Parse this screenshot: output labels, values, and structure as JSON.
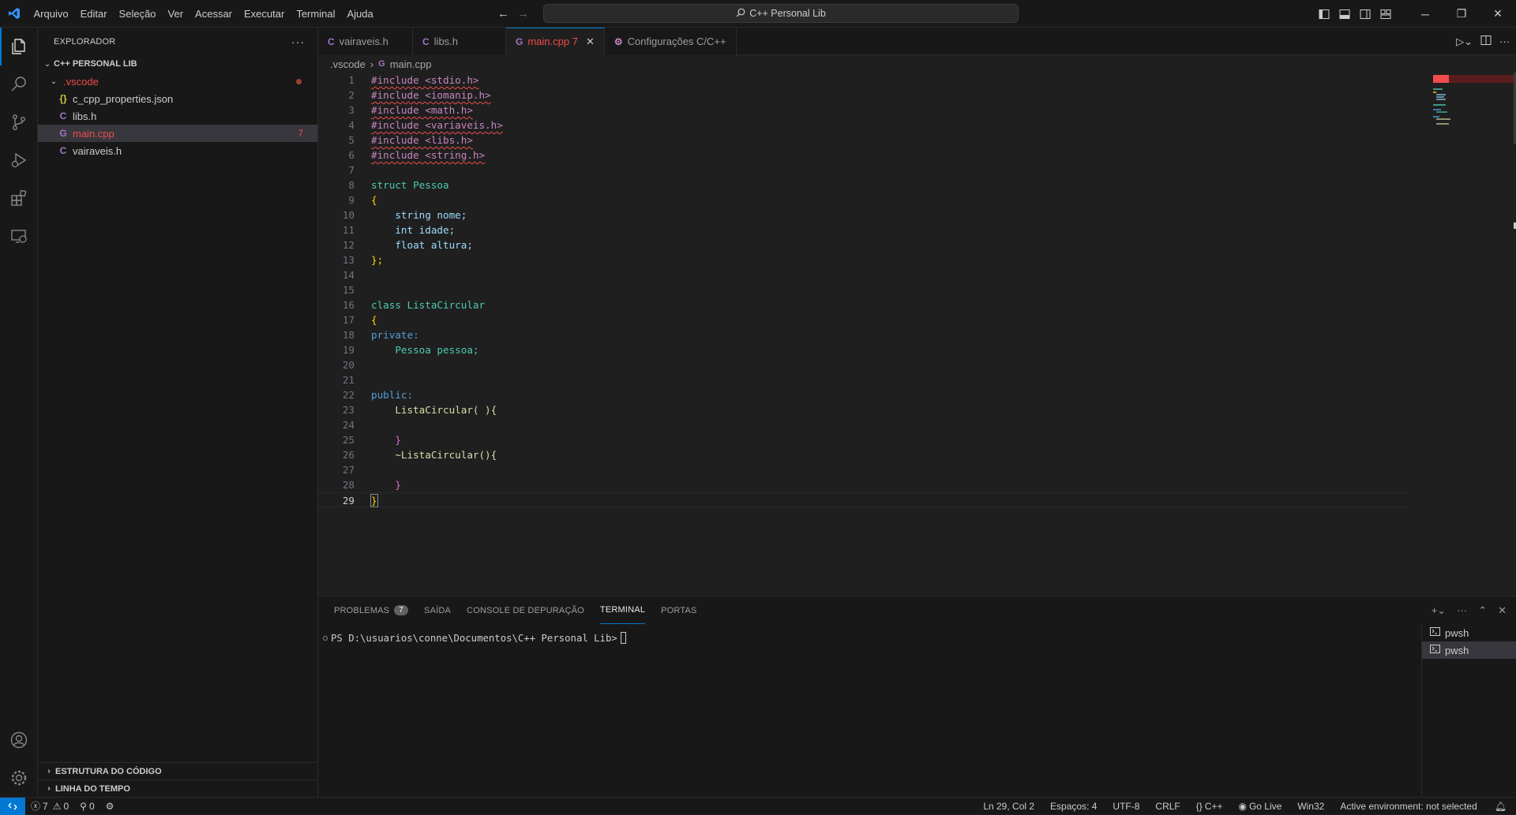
{
  "menu": [
    "Arquivo",
    "Editar",
    "Seleção",
    "Ver",
    "Acessar",
    "Executar",
    "Terminal",
    "Ajuda"
  ],
  "command_center": "C++ Personal Lib",
  "sidebar": {
    "title": "EXPLORADOR",
    "root": "C++ PERSONAL LIB",
    "folder": ".vscode",
    "files": [
      {
        "name": "c_cpp_properties.json",
        "icon": "{}"
      },
      {
        "name": "libs.h",
        "icon": "C"
      },
      {
        "name": "main.cpp",
        "icon": "G",
        "badge": "7"
      },
      {
        "name": "vairaveis.h",
        "icon": "C"
      }
    ],
    "sections": [
      "ESTRUTURA DO CÓDIGO",
      "LINHA DO TEMPO"
    ]
  },
  "tabs": [
    {
      "label": "vairaveis.h",
      "icon": "C"
    },
    {
      "label": "libs.h",
      "icon": "C"
    },
    {
      "label": "main.cpp 7",
      "icon": "G"
    },
    {
      "label": "Configurações C/C++",
      "icon": "⚙"
    }
  ],
  "breadcrumb": [
    ".vscode",
    "main.cpp"
  ],
  "code_lines": [
    "#include <stdio.h>",
    "#include <iomanip.h>",
    "#include <math.h>",
    "#include <variaveis.h>",
    "#include <libs.h>",
    "#include <string.h>",
    "",
    "struct Pessoa",
    "{",
    "    string nome;",
    "    int idade;",
    "    float altura;",
    "};",
    "",
    "",
    "class ListaCircular",
    "{",
    "private:",
    "    Pessoa pessoa;",
    "",
    "",
    "public:",
    "    ListaCircular( ){",
    "",
    "    }",
    "    ~ListaCircular(){",
    "",
    "    }",
    "}"
  ],
  "panel": {
    "tabs": [
      "PROBLEMAS",
      "SAÍDA",
      "CONSOLE DE DEPURAÇÃO",
      "TERMINAL",
      "PORTAS"
    ],
    "problems_count": "7",
    "prompt": "PS D:\\usuarios\\conne\\Documentos\\C++ Personal Lib>",
    "terminals": [
      "pwsh",
      "pwsh"
    ]
  },
  "status": {
    "errors": "7",
    "warnings": "0",
    "ports": "0",
    "position": "Ln 29, Col 2",
    "spaces": "Espaços: 4",
    "encoding": "UTF-8",
    "eol": "CRLF",
    "language": "C++",
    "golive": "Go Live",
    "platform": "Win32",
    "environment": "Active environment: not selected"
  }
}
